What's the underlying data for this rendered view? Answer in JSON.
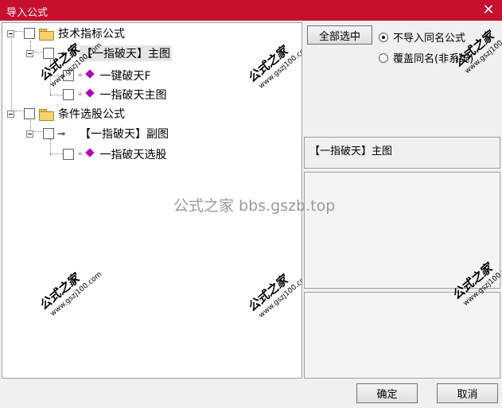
{
  "window": {
    "title": "导入公式"
  },
  "tree": {
    "groups": [
      {
        "label": "技术指标公式",
        "children": [
          {
            "label": "【一指破天】主图",
            "children": [
              {
                "label": "一键破天F"
              },
              {
                "label": "一指破天主图"
              }
            ]
          }
        ]
      },
      {
        "label": "条件选股公式",
        "children": [
          {
            "label": "【一指破天】副图",
            "children": [
              {
                "label": "一指破天选股"
              }
            ]
          }
        ]
      }
    ]
  },
  "options": {
    "select_all_label": "全部选中",
    "radio_skip_label": "不导入同名公式",
    "radio_overwrite_label": "覆盖同名(非系统)"
  },
  "info": {
    "formula_name": "【一指破天】主图"
  },
  "watermark": {
    "site_big": "公式之家",
    "site_url": "www.gszj100.com",
    "center_text": "公式之家 bbs.gszb.top"
  },
  "footer": {
    "ok_label": "确定",
    "cancel_label": "取消"
  }
}
